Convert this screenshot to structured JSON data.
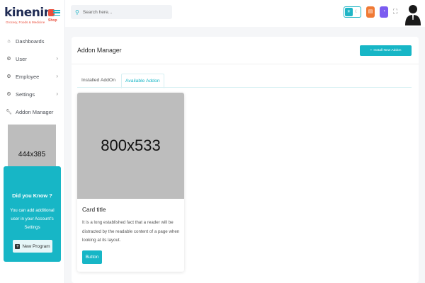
{
  "brand": {
    "name": "kinenin",
    "shop": "Shop",
    "tagline": "Grocery, Foods & Medicine"
  },
  "sidebar": {
    "items": [
      {
        "label": "Dashboards",
        "icon": "home-icon",
        "has_submenu": false
      },
      {
        "label": "User",
        "icon": "gear-icon",
        "has_submenu": true
      },
      {
        "label": "Employee",
        "icon": "gear-icon",
        "has_submenu": true
      },
      {
        "label": "Settings",
        "icon": "gear-icon",
        "has_submenu": true
      },
      {
        "label": "Addon Manager",
        "icon": "wrench-icon",
        "has_submenu": false
      }
    ],
    "image_placeholder": "444x385",
    "promo": {
      "title": "Did you Know ?",
      "text": "You can add additional user in your Account's Settings",
      "button_label": "New Program"
    }
  },
  "topbar": {
    "search_placeholder": "Search here...",
    "colors": {
      "accent": "#17b6c6",
      "orange": "#f07a35",
      "purple": "#7b5cf0"
    }
  },
  "main": {
    "title": "Addon Manager",
    "install_button": "Install New Addon",
    "tabs": [
      {
        "label": "Installed AddOn",
        "active": false
      },
      {
        "label": "Available Addon",
        "active": true
      }
    ],
    "card": {
      "image_placeholder": "800x533",
      "title": "Card title",
      "text": "It is a long established fact that a reader will be distracted by the readable content of a page when looking at its layout.",
      "button_label": "Button"
    }
  }
}
